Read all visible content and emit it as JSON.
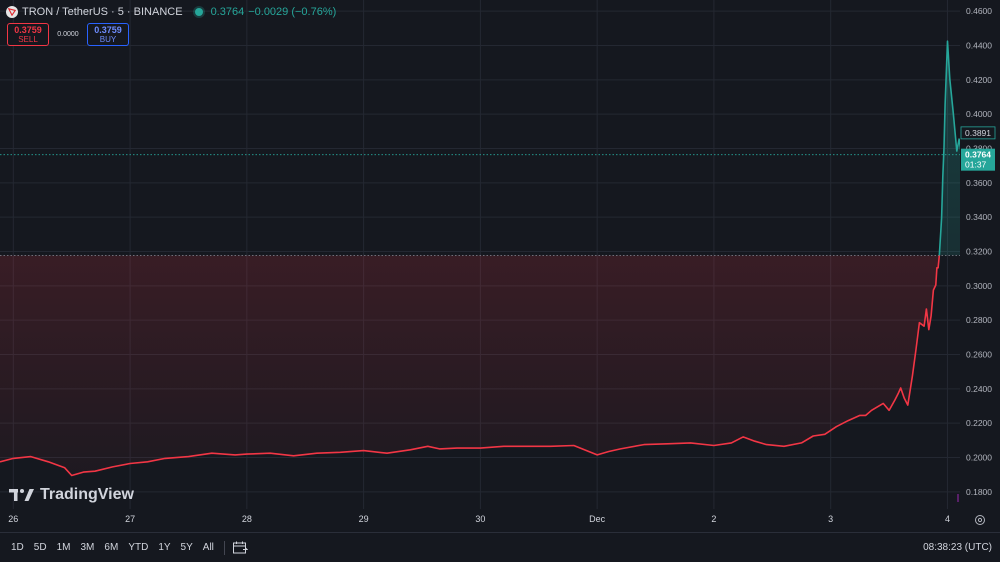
{
  "header": {
    "symbol": "TRON / TetherUS · 5 · BINANCE",
    "quote_last": "0.3764",
    "quote_change": "−0.0029 (−0.76%)"
  },
  "trade": {
    "sell_price": "0.3759",
    "sell_label": "SELL",
    "spread": "0.0000",
    "buy_price": "0.3759",
    "buy_label": "BUY"
  },
  "price_badge": {
    "value": "0.3764",
    "countdown": "01:37"
  },
  "hover_label": "0.3891",
  "branding": {
    "name": "TradingView"
  },
  "bottom": {
    "timeframes": [
      "1D",
      "5D",
      "1M",
      "3M",
      "6M",
      "YTD",
      "1Y",
      "5Y",
      "All"
    ],
    "clock": "08:38:23 (UTC)"
  },
  "colors": {
    "up": "#26a69a",
    "down": "#f23645",
    "bg": "#15181f",
    "grid": "#242832",
    "text": "#d1d4dc"
  },
  "icons": {
    "logo": "tron-logo-icon",
    "calendar": "calendar-range-icon",
    "settings": "gear-icon"
  },
  "chart_data": {
    "type": "area",
    "title": "",
    "xlabel": "",
    "ylabel": "",
    "ylim": [
      0.17,
      0.4665
    ],
    "yticks": [
      0.18,
      0.2,
      0.22,
      0.24,
      0.26,
      0.28,
      0.3,
      0.32,
      0.34,
      0.36,
      0.38,
      0.4,
      0.42,
      0.44,
      0.46
    ],
    "ytick_labels": [
      "0.1800",
      "0.2000",
      "0.2200",
      "0.2400",
      "0.2600",
      "0.2800",
      "0.3000",
      "0.3200",
      "0.3400",
      "0.3600",
      "0.3800",
      "0.4000",
      "0.4200",
      "0.4400",
      "0.4600"
    ],
    "xticks": [
      26,
      27,
      28,
      29,
      30,
      31,
      32,
      33,
      34
    ],
    "xtick_labels": [
      "26",
      "27",
      "28",
      "29",
      "30",
      "Dec",
      "2",
      "3",
      "4"
    ],
    "xlim": [
      25.886,
      34.45
    ],
    "baseline": 0.3177,
    "last_price": 0.3764,
    "x": [
      25.886,
      26.0,
      26.15,
      26.3,
      26.44,
      26.5,
      26.6,
      26.7,
      26.85,
      27.0,
      27.15,
      27.3,
      27.5,
      27.7,
      27.9,
      28.0,
      28.2,
      28.4,
      28.6,
      28.8,
      29.0,
      29.2,
      29.4,
      29.55,
      29.65,
      29.8,
      30.0,
      30.2,
      30.4,
      30.6,
      30.8,
      31.0,
      31.1,
      31.2,
      31.4,
      31.6,
      31.8,
      32.0,
      32.15,
      32.25,
      32.35,
      32.45,
      32.6,
      32.75,
      32.85,
      32.95,
      33.05,
      33.15,
      33.25,
      33.3,
      33.35,
      33.45,
      33.5,
      33.55,
      33.58,
      33.6,
      33.63,
      33.66,
      33.7,
      33.73,
      33.76,
      33.8,
      33.82,
      33.84,
      33.86,
      33.88,
      33.9,
      33.91,
      33.92,
      33.93,
      33.95,
      33.96,
      33.97,
      33.98,
      34.0,
      34.02,
      34.05,
      34.08,
      34.1,
      34.12,
      34.15,
      34.17,
      34.19,
      34.22,
      34.25,
      34.28,
      34.3,
      34.32
    ],
    "y": [
      0.1975,
      0.1995,
      0.2005,
      0.1975,
      0.194,
      0.1895,
      0.1915,
      0.192,
      0.1945,
      0.1965,
      0.1975,
      0.1995,
      0.2005,
      0.2025,
      0.2015,
      0.202,
      0.2025,
      0.201,
      0.2025,
      0.203,
      0.204,
      0.2025,
      0.2045,
      0.2065,
      0.205,
      0.2055,
      0.2055,
      0.2065,
      0.2065,
      0.2065,
      0.207,
      0.2015,
      0.2035,
      0.205,
      0.2075,
      0.208,
      0.2085,
      0.207,
      0.2085,
      0.212,
      0.2095,
      0.2075,
      0.2065,
      0.2085,
      0.2125,
      0.2135,
      0.218,
      0.2215,
      0.2245,
      0.2245,
      0.2275,
      0.2315,
      0.2275,
      0.2335,
      0.2375,
      0.2405,
      0.2345,
      0.2305,
      0.2475,
      0.2625,
      0.2785,
      0.2765,
      0.2865,
      0.2745,
      0.2825,
      0.2975,
      0.3005,
      0.3105,
      0.3105,
      0.3175,
      0.3395,
      0.3635,
      0.3805,
      0.4055,
      0.4425,
      0.4205,
      0.4005,
      0.3785,
      0.3855,
      0.3765,
      0.3985,
      0.4105,
      0.4265,
      0.3865,
      0.4065,
      0.4125,
      0.3905,
      0.3891
    ]
  }
}
